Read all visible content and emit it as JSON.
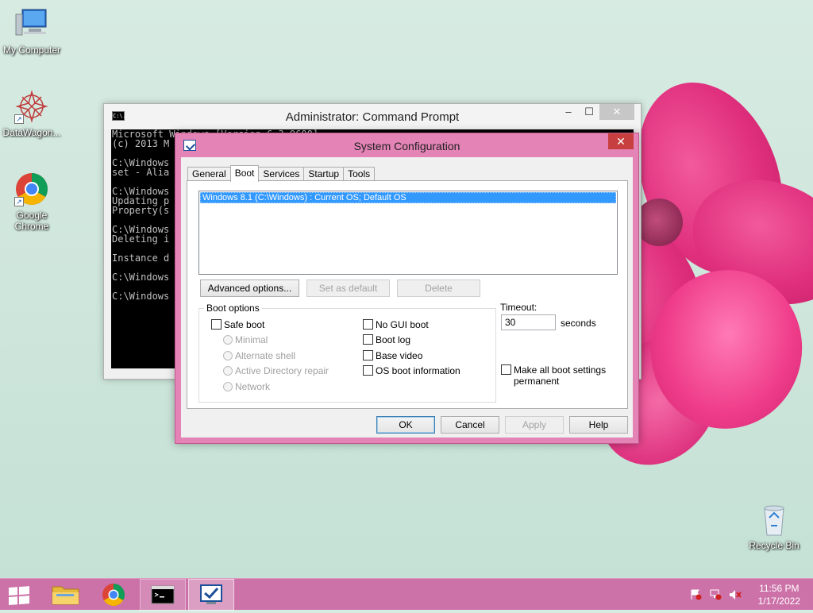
{
  "desktop": {
    "icons": [
      {
        "label": "My Computer"
      },
      {
        "label": "DataWagon..."
      },
      {
        "label": "Google Chrome"
      },
      {
        "label": "Recycle Bin"
      }
    ]
  },
  "cmd_window": {
    "title": "Administrator: Command Prompt",
    "icon_text": "C:\\.",
    "lines": [
      "Microsoft Windows [Version 6.3.9600]",
      "(c) 2013 M",
      "",
      "C:\\Windows",
      "set - Alia",
      "",
      "C:\\Windows",
      "Updating p",
      "Property(s",
      "",
      "C:\\Windows",
      "Deleting i",
      "",
      "Instance d",
      "",
      "C:\\Windows",
      "",
      "C:\\Windows"
    ],
    "buttons": {
      "minimize": "–",
      "maximize": "☐",
      "close": "✕"
    }
  },
  "sysconfig": {
    "title": "System Configuration",
    "close_glyph": "✕",
    "tabs": [
      "General",
      "Boot",
      "Services",
      "Startup",
      "Tools"
    ],
    "active_tab": "Boot",
    "os_entries": [
      "Windows 8.1 (C:\\Windows) : Current OS; Default OS"
    ],
    "buttons": {
      "advanced": "Advanced options...",
      "set_default": "Set as default",
      "delete": "Delete",
      "ok": "OK",
      "cancel": "Cancel",
      "apply": "Apply",
      "help": "Help"
    },
    "boot_options": {
      "label": "Boot options",
      "safe_boot": "Safe boot",
      "minimal": "Minimal",
      "alternate_shell": "Alternate shell",
      "ad_repair": "Active Directory repair",
      "network": "Network",
      "no_gui": "No GUI boot",
      "boot_log": "Boot log",
      "base_video": "Base video",
      "os_info": "OS boot information"
    },
    "timeout": {
      "label": "Timeout:",
      "value": "30",
      "unit": "seconds"
    },
    "permanent": {
      "line1": "Make all boot settings",
      "line2": "permanent"
    }
  },
  "taskbar": {
    "clock": {
      "time": "11:56 PM",
      "date": "1/17/2022"
    }
  },
  "colors": {
    "taskbar": "#cc72a9",
    "dialog_frame": "#e383b6",
    "selection": "#3399ff",
    "close_button": "#c7403f"
  }
}
